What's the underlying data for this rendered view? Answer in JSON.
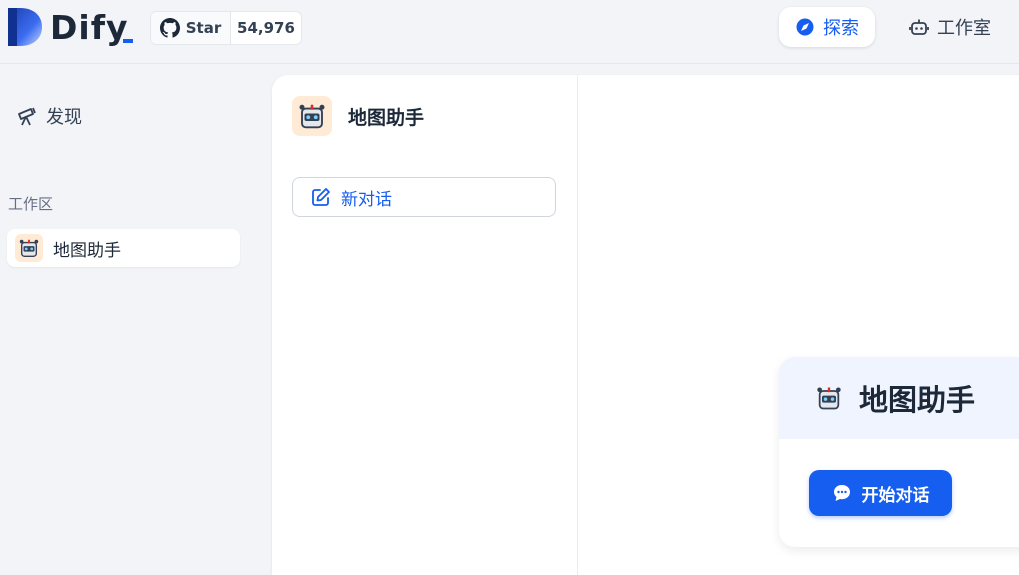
{
  "brand": {
    "name": "Dify"
  },
  "github": {
    "star_label": "Star",
    "star_count": "54,976"
  },
  "nav": {
    "explore_label": "探索",
    "studio_label": "工作室"
  },
  "sidebar": {
    "discover_label": "发现",
    "workspace_label": "工作区",
    "items": [
      {
        "label": "地图助手"
      }
    ]
  },
  "app": {
    "title": "地图助手",
    "new_chat_label": "新对话"
  },
  "welcome": {
    "title": "地图助手",
    "start_label": "开始对话"
  },
  "colors": {
    "accent": "#155eef",
    "avatar_bg": "#ffead5",
    "welcome_bg": "#eff4ff"
  },
  "icons": {
    "github": "github-icon",
    "explore": "compass-icon",
    "studio": "robot-icon",
    "discover": "telescope-icon",
    "new_chat": "edit-icon",
    "start": "chat-bubble-icon",
    "avatar": "robot-avatar-icon"
  }
}
